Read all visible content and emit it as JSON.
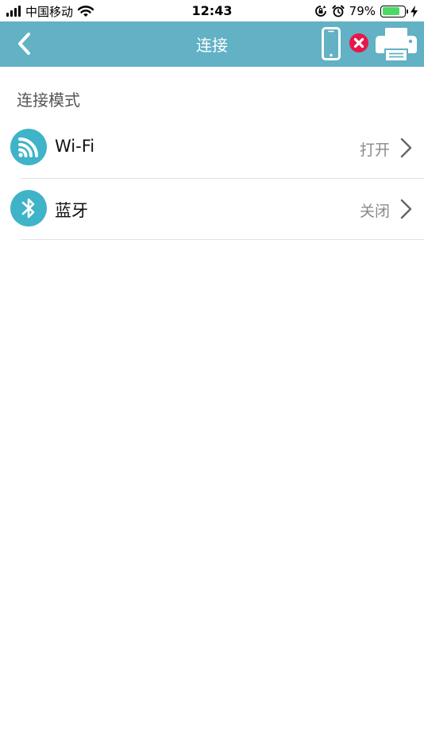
{
  "status_bar": {
    "carrier": "中国移动",
    "time": "12:43",
    "battery_percent": "79%",
    "battery_level": 0.79,
    "icons": [
      "signal-icon",
      "wifi-icon",
      "orientation-lock-icon",
      "alarm-icon",
      "battery-icon",
      "charging-icon"
    ]
  },
  "nav": {
    "title": "连接",
    "icons": [
      "back-icon",
      "phone-icon",
      "error-icon",
      "printer-icon"
    ]
  },
  "colors": {
    "nav_background": "#62b1c4",
    "accent": "#3fb3c8",
    "error": "#e8174a",
    "battery_green": "#4cd964"
  },
  "section": {
    "title": "连接模式"
  },
  "connections": [
    {
      "label": "Wi-Fi",
      "value": "打开",
      "icon": "wifi-icon"
    },
    {
      "label": "蓝牙",
      "value": "关闭",
      "icon": "bluetooth-icon"
    }
  ]
}
